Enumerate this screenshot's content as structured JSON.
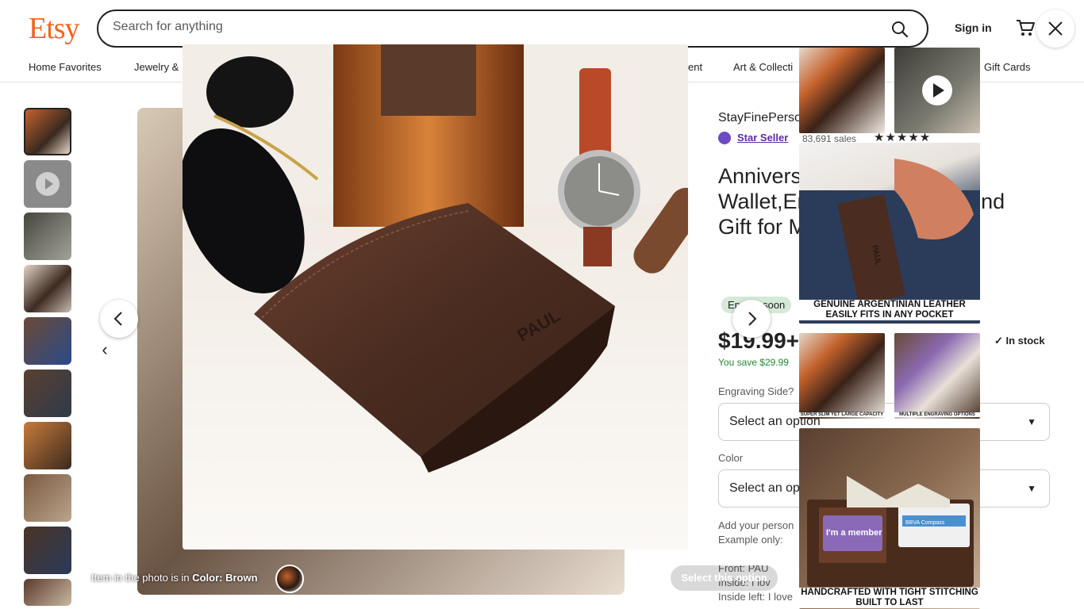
{
  "header": {
    "logo": "Etsy",
    "search_placeholder": "Search for anything",
    "sign_in": "Sign in"
  },
  "nav": {
    "items": [
      "Home Favorites",
      "Jewelry &",
      "ent",
      "Art & Collecti",
      "Gift Cards"
    ]
  },
  "listing": {
    "shop_name": "StayFinePerso",
    "star_seller": "Star Seller",
    "sales": "83,691 sales",
    "stars": "★★★★★",
    "title": "Annivers… Him,Pers… s Wallet,En… er Wallet,Cu… nd Gift for Men,C…",
    "badge": "Ending soon",
    "price": "$19.99+",
    "you_save": "You save $29.99",
    "in_stock": "In stock",
    "engraving_label": "Engraving Side?",
    "engraving_select": "Select an option",
    "color_label": "Color",
    "color_select": "Select an op",
    "personalization": "Add your person\nExample only:",
    "lines": [
      "Front: PAU",
      "Inside: I lov",
      "Inside left: I love"
    ]
  },
  "modal": {
    "caption_prefix": "Item in the photo is in ",
    "caption_bold": "Color: Brown",
    "select_option": "Select this option",
    "wallet_engraving": "PAUL"
  },
  "gallery": {
    "text1": "GENUINE ARGENTINIAN LEATHER\nEASILY FITS IN ANY POCKET",
    "small1": "SUPER SLIM YET LARGE CAPACITY",
    "small2": "MULTIPLE ENGRAVING OPTIONS",
    "text2": "HANDCRAFTED WITH TIGHT STITCHING\nBUILT TO LAST",
    "card_member": "I'm a member",
    "card_bank": "BBVA Compass",
    "pocket_engraving": "PAUL"
  }
}
